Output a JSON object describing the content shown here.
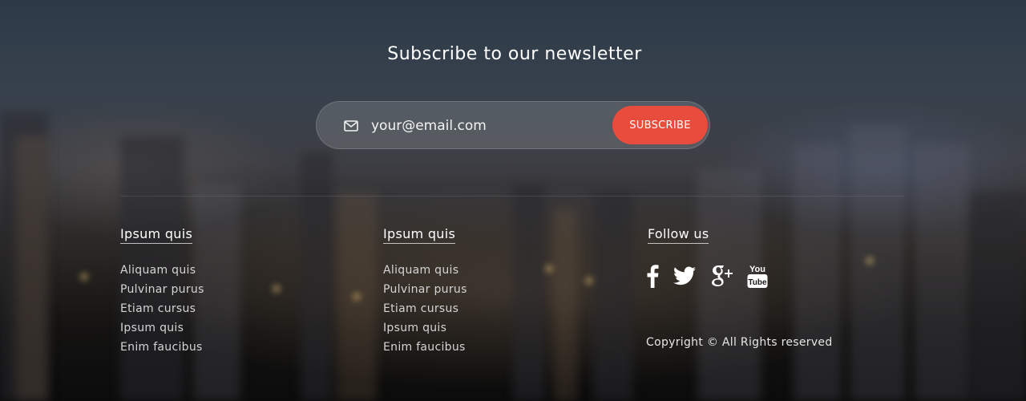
{
  "newsletter": {
    "title": "Subscribe to our newsletter",
    "email_placeholder": "your@email.com",
    "subscribe_label": "SUBSCRIBE"
  },
  "columns": [
    {
      "heading": "Ipsum quis",
      "links": [
        "Aliquam quis",
        "Pulvinar purus",
        "Etiam cursus",
        "Ipsum quis",
        "Enim faucibus"
      ]
    },
    {
      "heading": "Ipsum quis",
      "links": [
        "Aliquam quis",
        "Pulvinar purus",
        "Etiam cursus",
        "Ipsum quis",
        "Enim faucibus"
      ]
    }
  ],
  "follow": {
    "heading": "Follow us",
    "icons": [
      "facebook-icon",
      "twitter-icon",
      "google-plus-icon",
      "youtube-icon"
    ],
    "youtube_you": "You",
    "youtube_tube": "Tube"
  },
  "copyright": "Copyright © All Rights reserved",
  "colors": {
    "accent": "#e74c3c",
    "text": "#ffffff",
    "link": "#d4d4d4"
  }
}
